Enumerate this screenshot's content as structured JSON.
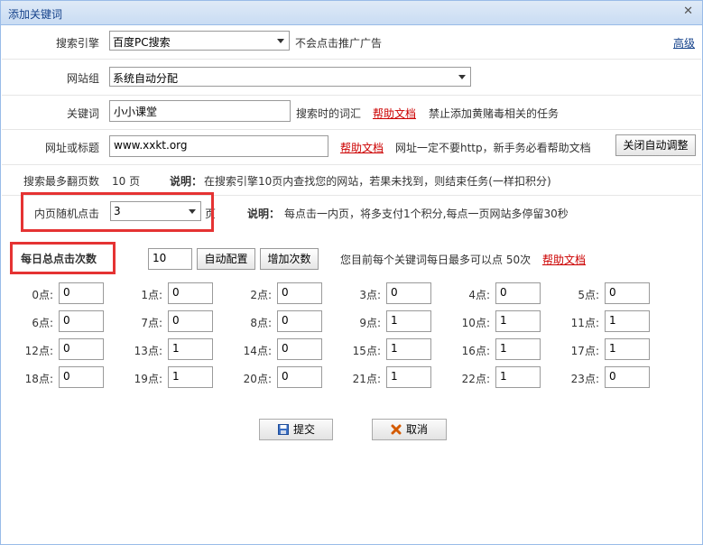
{
  "dialog": {
    "title": "添加关键词"
  },
  "engine": {
    "label": "搜索引擎",
    "value": "百度PC搜索",
    "note": "不会点击推广广告",
    "advanced": "高级"
  },
  "group": {
    "label": "网站组",
    "value": "系统自动分配"
  },
  "keyword": {
    "label": "关键词",
    "value": "小小课堂",
    "hint": "搜索时的词汇",
    "help": "帮助文档",
    "warning": "禁止添加黄赌毒相关的任务"
  },
  "url": {
    "label": "网址或标题",
    "value": "www.xxkt.org",
    "help": "帮助文档",
    "note": "网址一定不要http，新手务必看帮助文档",
    "button": "关闭自动调整"
  },
  "pages": {
    "label": "搜索最多翻页数",
    "value": "10 页",
    "desc_title": "说明：",
    "desc": "在搜索引擎10页内查找您的网站，若果未找到，则结束任务(一样扣积分)"
  },
  "inner": {
    "label": "内页随机点击",
    "value": "3",
    "unit": "页",
    "desc_title": "说明：",
    "desc": "每点击一内页，将多支付1个积分,每点一页网站多停留30秒"
  },
  "daily": {
    "label": "每日总点击次数",
    "value": "10",
    "auto_btn": "自动配置",
    "add_btn": "增加次数",
    "info": "您目前每个关键词每日最多可以点 50次",
    "help": "帮助文档"
  },
  "hours": [
    {
      "label": "0点:",
      "value": "0"
    },
    {
      "label": "1点:",
      "value": "0"
    },
    {
      "label": "2点:",
      "value": "0"
    },
    {
      "label": "3点:",
      "value": "0"
    },
    {
      "label": "4点:",
      "value": "0"
    },
    {
      "label": "5点:",
      "value": "0"
    },
    {
      "label": "6点:",
      "value": "0"
    },
    {
      "label": "7点:",
      "value": "0"
    },
    {
      "label": "8点:",
      "value": "0"
    },
    {
      "label": "9点:",
      "value": "1"
    },
    {
      "label": "10点:",
      "value": "1"
    },
    {
      "label": "11点:",
      "value": "1"
    },
    {
      "label": "12点:",
      "value": "0"
    },
    {
      "label": "13点:",
      "value": "1"
    },
    {
      "label": "14点:",
      "value": "0"
    },
    {
      "label": "15点:",
      "value": "1"
    },
    {
      "label": "16点:",
      "value": "1"
    },
    {
      "label": "17点:",
      "value": "1"
    },
    {
      "label": "18点:",
      "value": "0"
    },
    {
      "label": "19点:",
      "value": "1"
    },
    {
      "label": "20点:",
      "value": "0"
    },
    {
      "label": "21点:",
      "value": "1"
    },
    {
      "label": "22点:",
      "value": "1"
    },
    {
      "label": "23点:",
      "value": "0"
    }
  ],
  "actions": {
    "submit": "提交",
    "cancel": "取消"
  },
  "colors": {
    "highlight_border": "#e53333",
    "link": "#cc0000",
    "title_text": "#15428b"
  }
}
